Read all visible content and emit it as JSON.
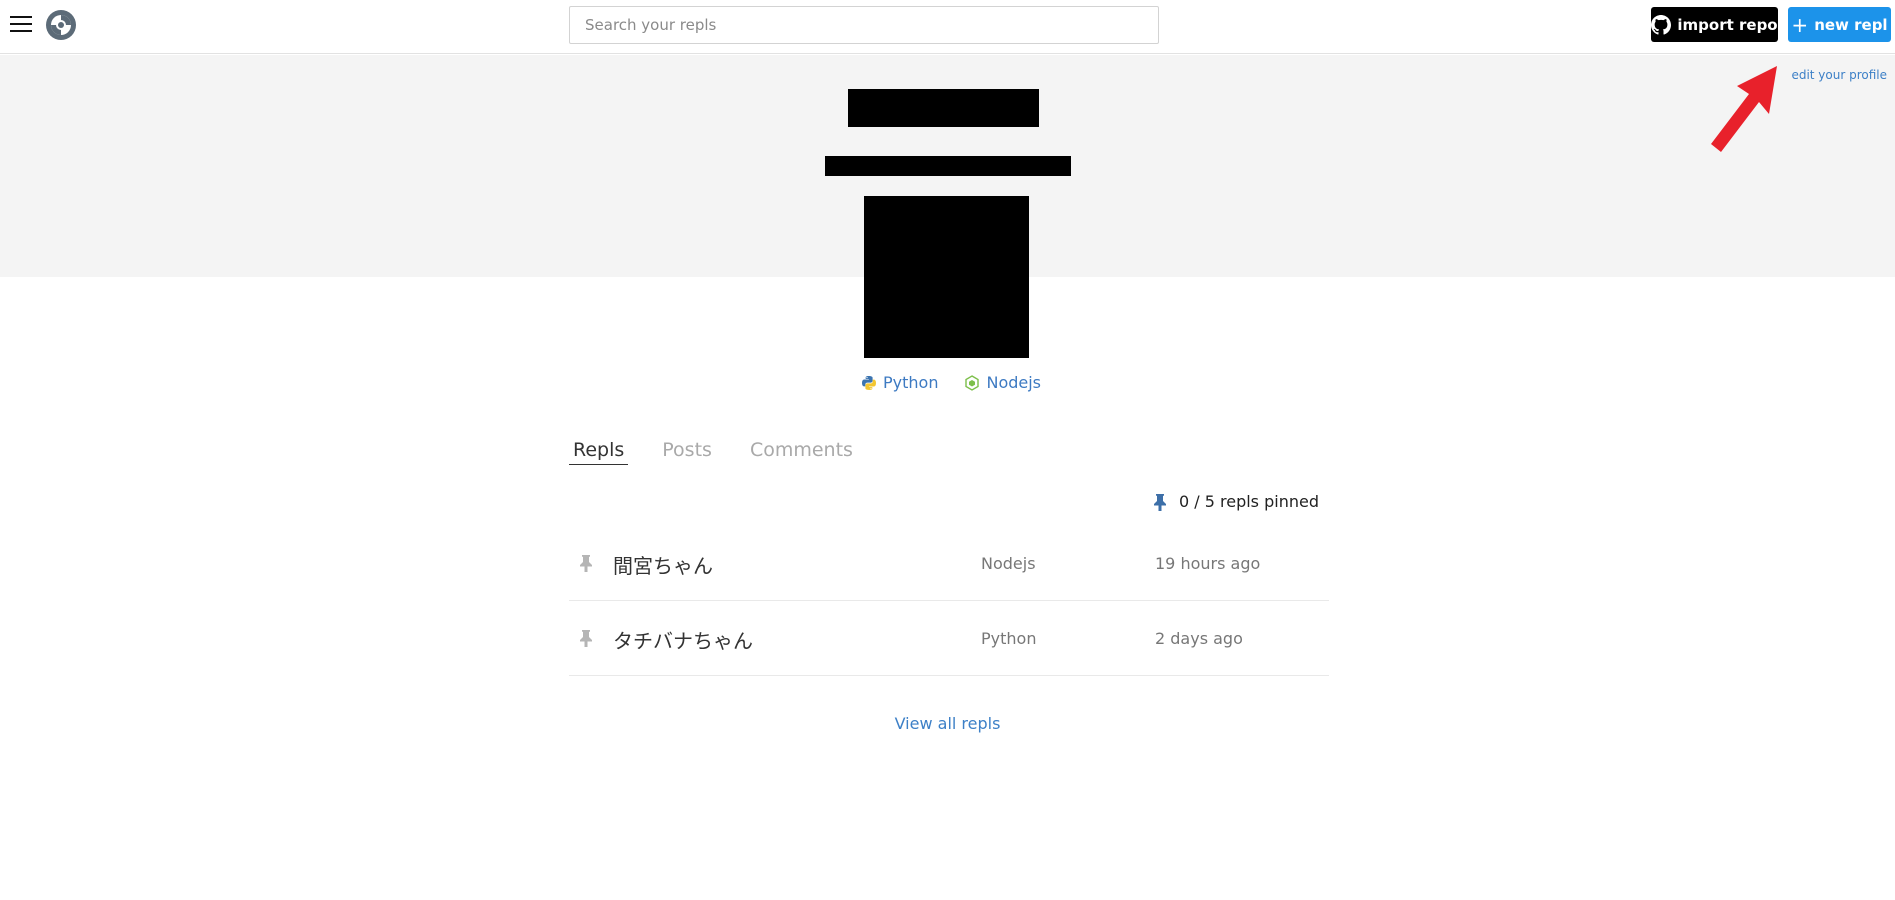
{
  "header": {
    "search_placeholder": "Search your repls",
    "import_label": "import repo",
    "new_label": "new repl",
    "new_icon": "+"
  },
  "profile": {
    "edit_label": "edit your profile",
    "languages": [
      {
        "name": "Python",
        "icon": "python-icon"
      },
      {
        "name": "Nodejs",
        "icon": "nodejs-icon"
      }
    ]
  },
  "tabs": [
    {
      "label": "Repls",
      "active": true
    },
    {
      "label": "Posts",
      "active": false
    },
    {
      "label": "Comments",
      "active": false
    }
  ],
  "pinned": {
    "label": "0 / 5 repls pinned"
  },
  "repls": [
    {
      "title": "間宮ちゃん",
      "language": "Nodejs",
      "updated": "19 hours ago"
    },
    {
      "title": "タチバナちゃん",
      "language": "Python",
      "updated": "2 days ago"
    }
  ],
  "view_all_label": "View all repls",
  "colors": {
    "accent": "#1c93ea",
    "link": "#3d80c7",
    "import_bg": "#000000",
    "arrow": "#e8212b",
    "profile_bg": "#f4f4f4"
  }
}
